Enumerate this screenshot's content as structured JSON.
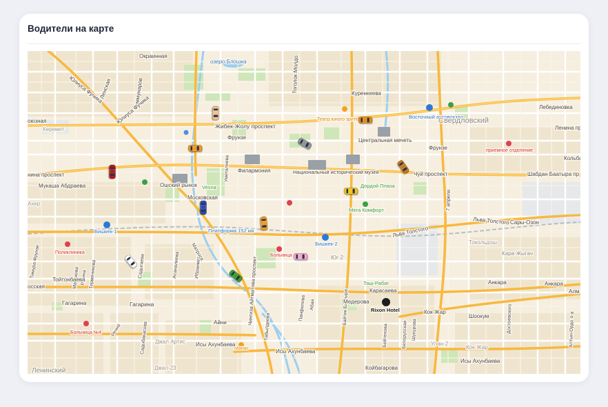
{
  "card": {
    "title": "Водители на карте"
  },
  "map": {
    "colors": {
      "land": "#f6efe0",
      "block": "#ede3cc",
      "park": "#cfe6b8",
      "major_road": "#f7b940",
      "street": "#ffffff",
      "water": "#9ccff0",
      "industrial": "#e5e7ea"
    },
    "labels": {
      "okrainnaya": "Окраинная",
      "ozero": "озеро Блошка",
      "lenskaya": "Ленская",
      "kommunarov": "Коммунаров",
      "yuliusa1": "Юлиуса Фучика",
      "yuliusa2": "Юлиуса Фучика",
      "togolok": "Тоголок Молдо",
      "kurenkeeva": "Куренкеева",
      "lebedinovka": "Лебединовка",
      "vostochny": "Восточный автовокзал",
      "teatr": "Театр юного зрителя",
      "sverdlovsky": "Свердловский",
      "kojoznaya": "оюзная",
      "keremet": "Керемет",
      "zhibek": "Жибек-Жолу проспект",
      "lenina1": "Ленина пр",
      "frunze1": "Фрунзе",
      "frunze2": "Фрунзе",
      "mechet": "Центральная мечеть",
      "priemnoe": "приемное отделение",
      "kolba": "Кольба",
      "prospekt_left": "нина проспект",
      "umetalieva": "Уметалиева",
      "filarmonia": "Филармония",
      "muzey": "Национальный исторический музей",
      "chuy": "Чуй проспект",
      "shabdan": "Шабдан Баатыра пр",
      "mukasha": "Мукаша Абдраева",
      "osh": "Ошский рынок",
      "vesna": "Vesna",
      "dordoi": "Дордой Плаза",
      "akhera": "Ахер",
      "moskovskaya": "Московская",
      "mega": "Мега Комфорт",
      "aprel": "7 апреля",
      "lva_tolstogo1": "Льва Толстого",
      "lva_tolstogo2": "Льва Толстого",
      "sary_ozon": "Сары-Озон",
      "bishkek1": "Бишкек-1",
      "platforma": "Платформа 152 км",
      "bishkek2": "Бишкек-2",
      "tokolsh": "Токольдош",
      "poliklinika": "Поликлиника",
      "tymyra": "Тимура Фрунзе",
      "malikova": "Малькова",
      "regina": "Регина",
      "termechikov": "Термечикова",
      "sadygaeva": "Садыгаева",
      "asanalieva": "Асаналиева",
      "ibraimova": "Ибраимова",
      "matrosa": "Матроса",
      "bolnica": "Больница",
      "yug2": "Юг-2",
      "kara_zhygach": "Кара-Жыгач",
      "toitonbaeva": "Тойтонбаева",
      "tash_rabat": "Таш-Рабат",
      "karasaeva": "Карасаева",
      "ankara": "Анкара",
      "ankara2": "Анкара",
      "alma": "Алм",
      "kosskaya": "осская",
      "gagarina1": "Гагарина",
      "gagarina2": "Гагарина",
      "aitmatova": "Чингиза Айтматова проспект",
      "pahlina": "Панфилова",
      "abaya": "Абая",
      "baitik": "Байтик Баатыра",
      "mederova": "Медерова",
      "rixon": "Rixon Hotel",
      "kokzhar1": "Кок-Жар",
      "shookum": "Шоокум",
      "dostoevskogo": "Достоевского",
      "altyn": "Алтын-Ордо 4-а",
      "aini": "Айни",
      "tabyldieva": "Табылдиева",
      "bolnica4": "Больница №4",
      "rechna": "Речна",
      "jal_artis": "Джал Артис",
      "manas": "Манас",
      "isy1": "Исы Ахунбаева",
      "isy2": "Исы Ахунбаева",
      "isy3": "Исы Ахунбаева",
      "ulan": "Улан-2",
      "kokzhar2": "Кок-Жар",
      "beltenova": "Бейтенова",
      "belorusskaya": "Белорусская",
      "shukurova": "Шукурова",
      "leninsky": "Ленинский",
      "jal23": "Джал-23",
      "koibagarova": "Койбагарова",
      "sadybakas": "Садыбакасова"
    },
    "cars": [
      {
        "color": "#f0c38e"
      },
      {
        "color": "#f39a1e"
      },
      {
        "color": "#e88b16"
      },
      {
        "color": "#8f9399"
      },
      {
        "color": "#b5191f"
      },
      {
        "color": "#c87721"
      },
      {
        "color": "#f3c51c"
      },
      {
        "color": "#2a49b5"
      },
      {
        "color": "#f39a1e"
      },
      {
        "color": "#f4a7d1"
      },
      {
        "color": "#ffffff"
      },
      {
        "color": "#3a9d2e"
      }
    ]
  }
}
